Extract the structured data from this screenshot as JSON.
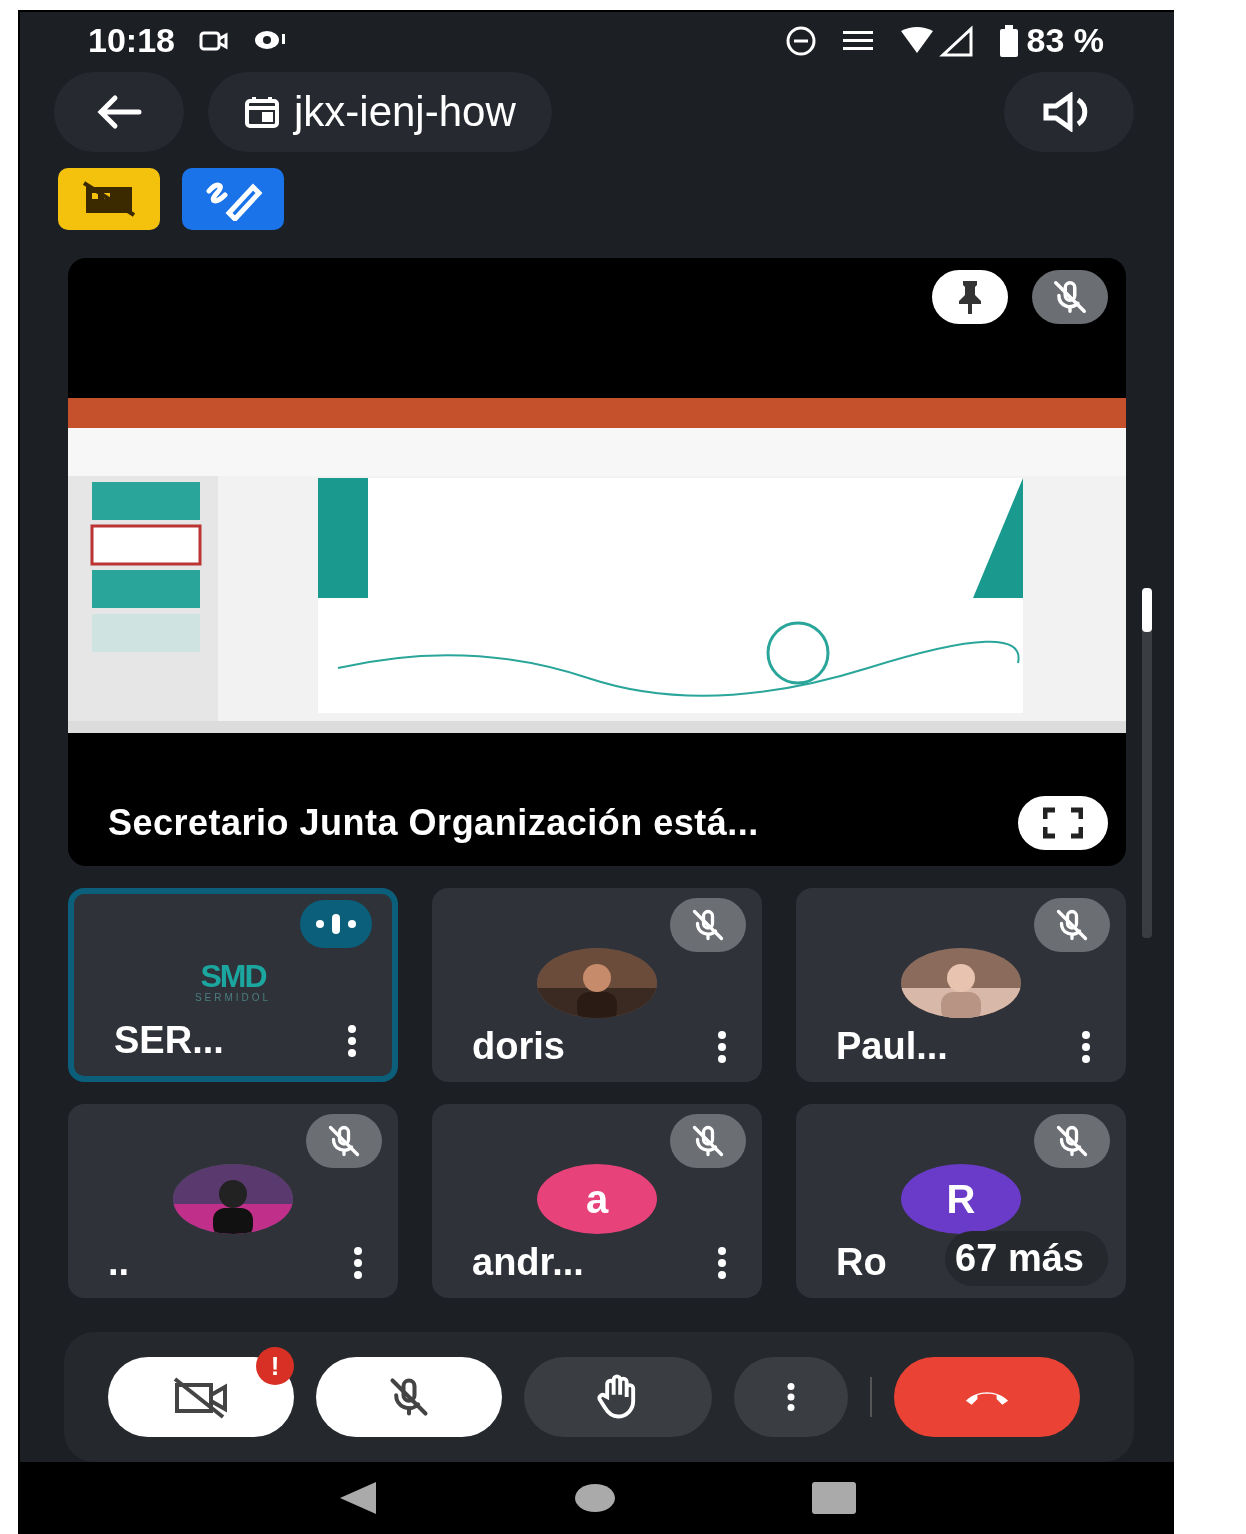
{
  "status_bar": {
    "time": "10:18",
    "battery": "83 %"
  },
  "top_bar": {
    "meeting_code": "jkx-ienj-how"
  },
  "chips": [
    {
      "kind": "building",
      "color": "#f4c20d"
    },
    {
      "kind": "pen",
      "color": "#1a73e8"
    }
  ],
  "stage": {
    "presenter": "Secretario Junta Organización está...",
    "pinned": true,
    "muted": true
  },
  "tiles": [
    {
      "name": "SER...",
      "kind": "logo",
      "logo": "SMD",
      "logo_sub": "SERMIDOL",
      "speaking": true,
      "muted": false
    },
    {
      "name": "doris",
      "kind": "picture",
      "speaking": false,
      "muted": true
    },
    {
      "name": "Paul...",
      "kind": "picture",
      "speaking": false,
      "muted": true
    },
    {
      "name": "..",
      "kind": "picture",
      "speaking": false,
      "muted": true
    },
    {
      "name": "andr...",
      "kind": "letter",
      "letter": "a",
      "color": "#e8427a",
      "speaking": false,
      "muted": true
    },
    {
      "name": "Ro",
      "kind": "letter",
      "letter": "R",
      "color": "#6a3bc9",
      "speaking": false,
      "muted": true,
      "overlay": "67 más"
    }
  ],
  "controls": [
    {
      "kind": "camera",
      "on": false,
      "alert": "!"
    },
    {
      "kind": "mic",
      "on": false
    },
    {
      "kind": "hand"
    },
    {
      "kind": "more"
    },
    {
      "kind": "hangup"
    }
  ]
}
